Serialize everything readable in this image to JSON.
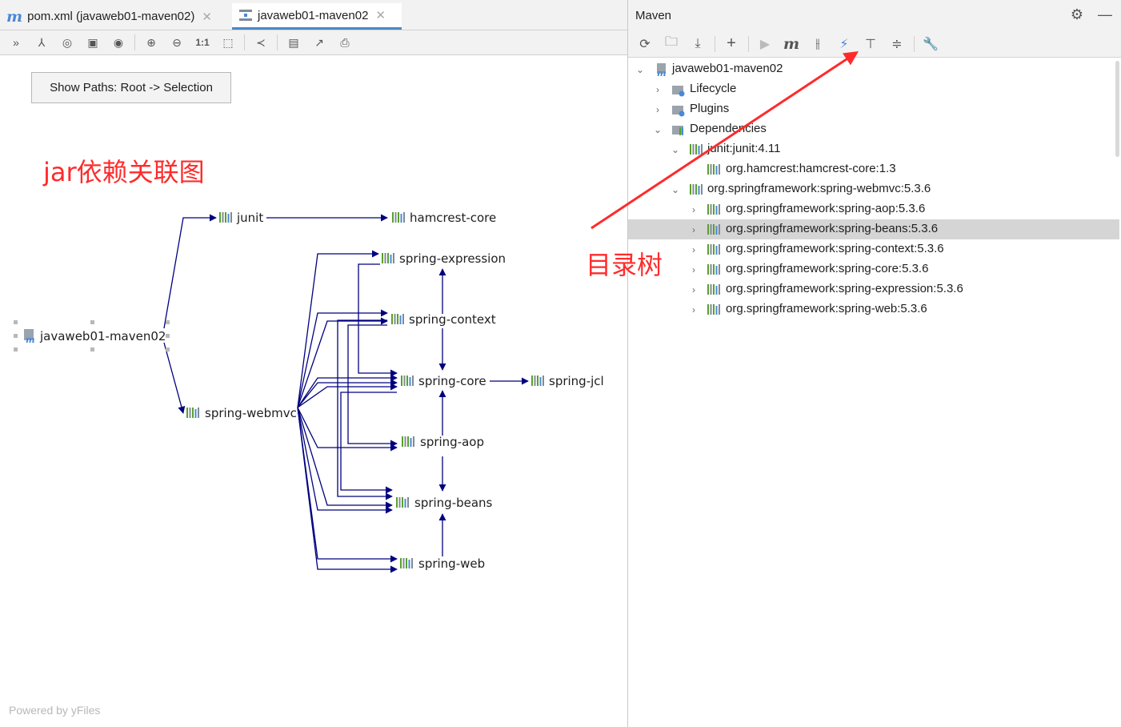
{
  "editor": {
    "tabs": [
      {
        "label": "pom.xml (javaweb01-maven02)",
        "active": false
      },
      {
        "label": "javaweb01-maven02",
        "active": true
      }
    ],
    "toolbar_icons": [
      "collapse-icon",
      "layout-icon",
      "select-icon",
      "fit-icon",
      "eye-icon",
      "zoom-in-icon",
      "zoom-out-icon",
      "actual-size-icon",
      "fit-content-icon",
      "share-icon",
      "save-icon",
      "export-icon",
      "print-icon"
    ],
    "actual_size_label": "1:1",
    "show_paths_button": "Show Paths: Root -> Selection",
    "annotation": "jar依赖关联图",
    "powered_by": "Powered by yFiles"
  },
  "graph": {
    "nodes": {
      "root": "javaweb01-maven02",
      "junit": "junit",
      "hamcrest": "hamcrest-core",
      "webmvc": "spring-webmvc",
      "expression": "spring-expression",
      "context": "spring-context",
      "core": "spring-core",
      "jcl": "spring-jcl",
      "aop": "spring-aop",
      "beans": "spring-beans",
      "web": "spring-web"
    }
  },
  "maven": {
    "title": "Maven",
    "toolbar_icons": [
      "reload-icon",
      "add-maven-project-icon",
      "download-icon",
      "add-icon",
      "run-icon",
      "execute-goal-icon",
      "toggle-offline-icon",
      "skip-tests-icon",
      "show-dependencies-icon",
      "collapse-all-icon",
      "settings-wrench-icon"
    ],
    "tree": [
      {
        "label": "javaweb01-maven02",
        "chevron": "down"
      },
      {
        "label": "Lifecycle",
        "chevron": "right"
      },
      {
        "label": "Plugins",
        "chevron": "right"
      },
      {
        "label": "Dependencies",
        "chevron": "down"
      },
      {
        "label": "junit:junit:4.11",
        "chevron": "down"
      },
      {
        "label": "org.hamcrest:hamcrest-core:1.3",
        "chevron": ""
      },
      {
        "label": "org.springframework:spring-webmvc:5.3.6",
        "chevron": "down"
      },
      {
        "label": "org.springframework:spring-aop:5.3.6",
        "chevron": "right"
      },
      {
        "label": "org.springframework:spring-beans:5.3.6",
        "chevron": "right",
        "selected": true
      },
      {
        "label": "org.springframework:spring-context:5.3.6",
        "chevron": "right"
      },
      {
        "label": "org.springframework:spring-core:5.3.6",
        "chevron": "right"
      },
      {
        "label": "org.springframework:spring-expression:5.3.6",
        "chevron": "right"
      },
      {
        "label": "org.springframework:spring-web:5.3.6",
        "chevron": "right"
      }
    ],
    "annotation": "目录树"
  },
  "colors": {
    "edge": "#00007f",
    "annotation": "#ff2b2b",
    "maven_blue": "#4a88d8",
    "lib_green": "#5aa02c"
  }
}
